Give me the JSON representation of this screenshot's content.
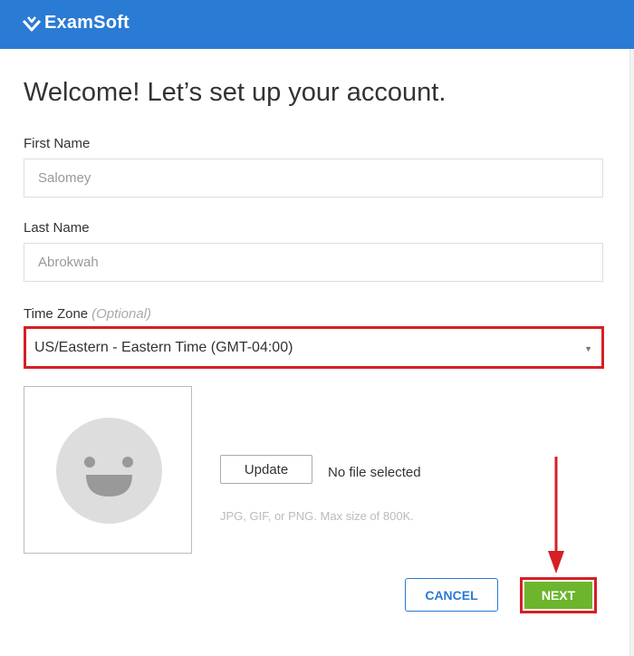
{
  "header": {
    "logo_text": "ExamSoft",
    "logo_icon": "examsoft-chevron-logo",
    "background_color": "#2a7bd4"
  },
  "form": {
    "title": "Welcome! Let’s set up your account.",
    "first_name": {
      "label": "First Name",
      "value": "Salomey"
    },
    "last_name": {
      "label": "Last Name",
      "value": "Abrokwah"
    },
    "time_zone": {
      "label": "Time Zone",
      "optional_text": "(Optional)",
      "selected": "US/Eastern - Eastern Time (GMT-04:00)"
    }
  },
  "avatar": {
    "icon": "smiley-face-avatar-icon",
    "update_label": "Update",
    "file_status": "No file selected",
    "hint": "JPG, GIF, or PNG. Max size of 800K."
  },
  "actions": {
    "cancel_label": "CANCEL",
    "next_label": "NEXT"
  },
  "annotations": {
    "highlight_color": "#d61f26",
    "arrow_icon": "red-down-arrow"
  },
  "colors": {
    "accent": "#2a7bd4",
    "next_button": "#6cb52d"
  }
}
